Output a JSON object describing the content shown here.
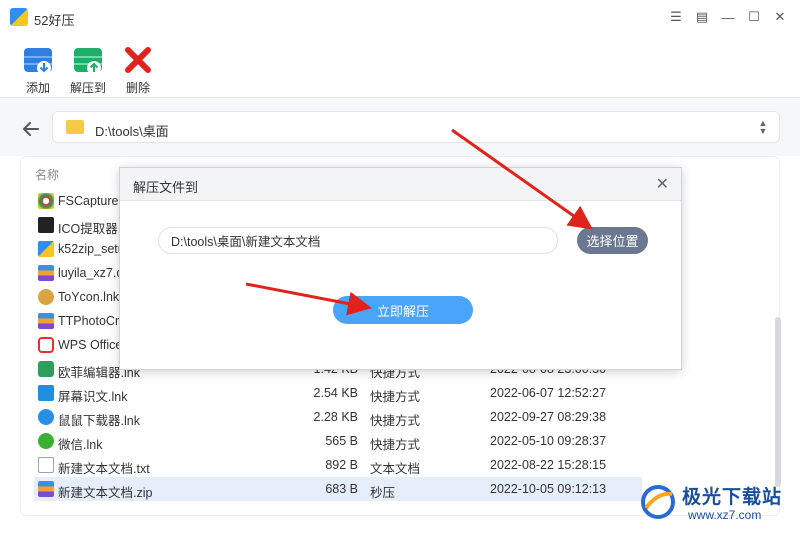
{
  "app": {
    "title": "52好压"
  },
  "window_controls": [
    {
      "name": "list-icon",
      "glyph": "☰"
    },
    {
      "name": "message-icon",
      "glyph": "▤"
    },
    {
      "name": "minimize-icon",
      "glyph": "—"
    },
    {
      "name": "maximize-icon",
      "glyph": "☐"
    },
    {
      "name": "close-icon",
      "glyph": "✕"
    }
  ],
  "toolbar": {
    "add_label": "添加",
    "extract_label": "解压到",
    "delete_label": "删除"
  },
  "path_bar": {
    "path": "D:\\tools\\桌面"
  },
  "list": {
    "header_name": "名称",
    "rows": [
      {
        "name": "FSCapture.e",
        "size": "",
        "type": "",
        "date": "",
        "icon": "fscapture-icon",
        "color": "#d33a2c"
      },
      {
        "name": "ICO提取器.l",
        "size": "",
        "type": "",
        "date": "",
        "icon": "ico-extractor-icon",
        "color": "#222222"
      },
      {
        "name": "k52zip_setu",
        "size": "",
        "type": "",
        "date": "",
        "icon": "k52zip-icon",
        "color": "#f5c425"
      },
      {
        "name": "luyila_xz7.c",
        "size": "",
        "type": "",
        "date": "",
        "icon": "archive-icon",
        "color": "#e6883a"
      },
      {
        "name": "ToYcon.lnk",
        "size": "",
        "type": "",
        "date": "",
        "icon": "toycon-icon",
        "color": "#d9a441"
      },
      {
        "name": "TTPhotoCro",
        "size": "",
        "type": "",
        "date": "",
        "icon": "archive-icon",
        "color": "#e6883a"
      },
      {
        "name": "WPS Office",
        "size": "",
        "type": "",
        "date": "",
        "icon": "wps-icon",
        "color": "#e2322a"
      },
      {
        "name": "欧菲编辑器.lnk",
        "size": "1.42 KB",
        "type": "快捷方式",
        "date": "2022-08-08 23:00:30",
        "icon": "editor-icon",
        "color": "#2e9e5b"
      },
      {
        "name": "屏幕识文.lnk",
        "size": "2.54 KB",
        "type": "快捷方式",
        "date": "2022-06-07 12:52:27",
        "icon": "text-recognition-icon",
        "color": "#1f8fe0"
      },
      {
        "name": "鼠鼠下载器.lnk",
        "size": "2.28 KB",
        "type": "快捷方式",
        "date": "2022-09-27 08:29:38",
        "icon": "downloader-icon",
        "color": "#2a8ee8"
      },
      {
        "name": "微信.lnk",
        "size": "565 B",
        "type": "快捷方式",
        "date": "2022-05-10 09:28:37",
        "icon": "wechat-icon",
        "color": "#3cb034"
      },
      {
        "name": "新建文本文档.txt",
        "size": "892 B",
        "type": "文本文档",
        "date": "2022-08-22 15:28:15",
        "icon": "text-file-icon",
        "color": "#9aa3ad"
      },
      {
        "name": "新建文本文档.zip",
        "size": "683 B",
        "type": "秒压",
        "date": "2022-10-05 09:12:13",
        "icon": "archive-icon",
        "color": "#e6883a",
        "selected": true
      }
    ]
  },
  "dialog": {
    "title": "解压文件到",
    "path_value": "D:\\tools\\桌面\\新建文本文档",
    "choose_label": "选择位置",
    "extract_now_label": "立即解压"
  },
  "watermark": {
    "title": "极光下载站",
    "url": "www.xz7.com"
  },
  "colors": {
    "accent_blue": "#4aa4f7",
    "choose_button": "#6b7891",
    "annotation_red": "#e0231c",
    "selected_row": "#e6eefb"
  }
}
